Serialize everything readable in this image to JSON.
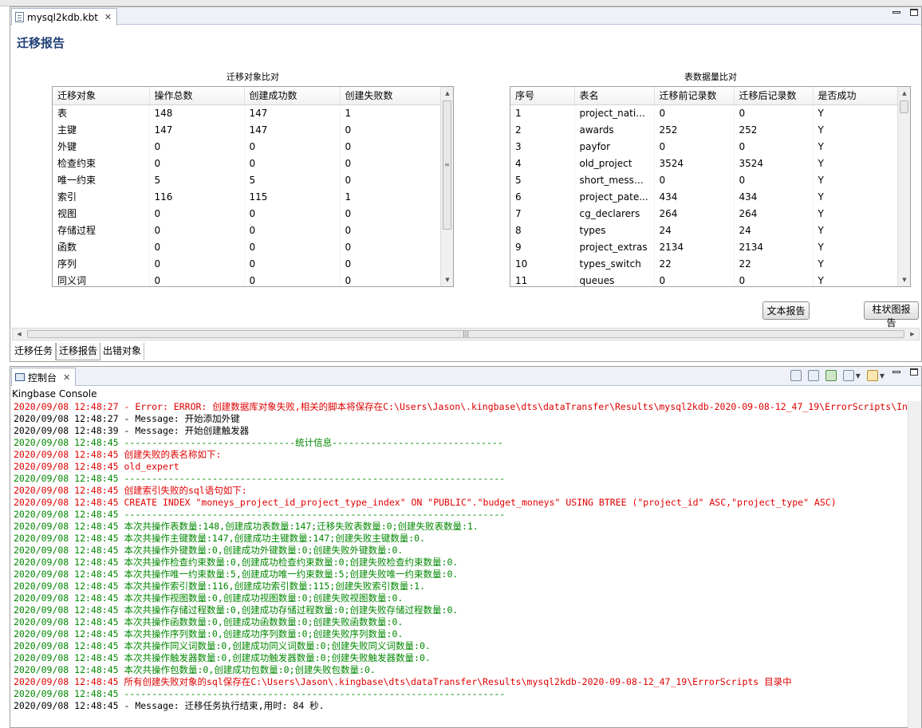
{
  "editor": {
    "tab_label": "mysql2kdb.kbt",
    "report_title": "迁移报告"
  },
  "object_compare": {
    "caption": "迁移对象比对",
    "columns": [
      "迁移对象",
      "操作总数",
      "创建成功数",
      "创建失败数"
    ],
    "rows": [
      [
        "表",
        "148",
        "147",
        "1"
      ],
      [
        "主键",
        "147",
        "147",
        "0"
      ],
      [
        "外键",
        "0",
        "0",
        "0"
      ],
      [
        "检查约束",
        "0",
        "0",
        "0"
      ],
      [
        "唯一约束",
        "5",
        "5",
        "0"
      ],
      [
        "索引",
        "116",
        "115",
        "1"
      ],
      [
        "视图",
        "0",
        "0",
        "0"
      ],
      [
        "存储过程",
        "0",
        "0",
        "0"
      ],
      [
        "函数",
        "0",
        "0",
        "0"
      ],
      [
        "序列",
        "0",
        "0",
        "0"
      ],
      [
        "同义词",
        "0",
        "0",
        "0"
      ]
    ]
  },
  "data_compare": {
    "caption": "表数据量比对",
    "columns": [
      "序号",
      "表名",
      "迁移前记录数",
      "迁移后记录数",
      "是否成功"
    ],
    "rows": [
      [
        "1",
        "project_natio...",
        "0",
        "0",
        "Y"
      ],
      [
        "2",
        "awards",
        "252",
        "252",
        "Y"
      ],
      [
        "3",
        "payfor",
        "0",
        "0",
        "Y"
      ],
      [
        "4",
        "old_project",
        "3524",
        "3524",
        "Y"
      ],
      [
        "5",
        "short_messa...",
        "0",
        "0",
        "Y"
      ],
      [
        "6",
        "project_pate...",
        "434",
        "434",
        "Y"
      ],
      [
        "7",
        "cg_declarers",
        "264",
        "264",
        "Y"
      ],
      [
        "8",
        "types",
        "24",
        "24",
        "Y"
      ],
      [
        "9",
        "project_extras",
        "2134",
        "2134",
        "Y"
      ],
      [
        "10",
        "types_switch",
        "22",
        "22",
        "Y"
      ],
      [
        "11",
        "queues",
        "0",
        "0",
        "Y"
      ]
    ]
  },
  "buttons": {
    "text_report": "文本报告",
    "bar_report": "柱状图报告"
  },
  "bottom_tabs": [
    "迁移任务",
    "迁移报告",
    "出错对象"
  ],
  "console": {
    "tab_label": "控制台",
    "label": "Kingbase Console",
    "colors": {
      "red": "#e00000",
      "green": "#008800",
      "black": "#000000"
    },
    "lines": [
      {
        "color": "red",
        "ts": "2020/09/08 12:48:27",
        "text": " - Error: ERROR: 创建数据库对象失败,相关的脚本将保存在C:\\Users\\Jason\\.kingbase\\dts\\dataTransfer\\Results\\mysql2kdb-2020-09-08-12_47_19\\ErrorScripts\\Indexes"
      },
      {
        "color": "black",
        "ts": "2020/09/08 12:48:27",
        "text": " - Message: 开始添加外键"
      },
      {
        "color": "black",
        "ts": "2020/09/08 12:48:39",
        "text": " - Message: 开始创建触发器"
      },
      {
        "color": "green",
        "ts": "2020/09/08 12:48:45",
        "text": " -------------------------------统计信息-------------------------------"
      },
      {
        "color": "red",
        "ts": "2020/09/08 12:48:45",
        "text": " 创建失败的表名称如下:"
      },
      {
        "color": "red",
        "ts": "2020/09/08 12:48:45",
        "text": " old_expert"
      },
      {
        "color": "green",
        "ts": "2020/09/08 12:48:45",
        "text": " ---------------------------------------------------------------------"
      },
      {
        "color": "red",
        "ts": "2020/09/08 12:48:45",
        "text": " 创建索引失败的sql语句如下:"
      },
      {
        "color": "red",
        "ts": "2020/09/08 12:48:45",
        "text": " CREATE  INDEX \"moneys_project_id_project_type_index\" ON \"PUBLIC\".\"budget_moneys\" USING BTREE (\"project_id\" ASC,\"project_type\" ASC)"
      },
      {
        "color": "green",
        "ts": "2020/09/08 12:48:45",
        "text": " ---------------------------------------------------------------------"
      },
      {
        "color": "green",
        "ts": "2020/09/08 12:48:45",
        "text": " 本次共操作表数量:148,创建成功表数量:147;迁移失败表数量:0;创建失败表数量:1."
      },
      {
        "color": "green",
        "ts": "2020/09/08 12:48:45",
        "text": " 本次共操作主键数量:147,创建成功主键数量:147;创建失败主键数量:0."
      },
      {
        "color": "green",
        "ts": "2020/09/08 12:48:45",
        "text": " 本次共操作外键数量:0,创建成功外键数量:0;创建失败外键数量:0."
      },
      {
        "color": "green",
        "ts": "2020/09/08 12:48:45",
        "text": " 本次共操作检查约束数量:0,创建成功检查约束数量:0;创建失败检查约束数量:0."
      },
      {
        "color": "green",
        "ts": "2020/09/08 12:48:45",
        "text": " 本次共操作唯一约束数量:5,创建成功唯一约束数量:5;创建失败唯一约束数量:0."
      },
      {
        "color": "green",
        "ts": "2020/09/08 12:48:45",
        "text": " 本次共操作索引数量:116,创建成功索引数量:115;创建失败索引数量:1."
      },
      {
        "color": "green",
        "ts": "2020/09/08 12:48:45",
        "text": " 本次共操作视图数量:0,创建成功视图数量:0;创建失败视图数量:0."
      },
      {
        "color": "green",
        "ts": "2020/09/08 12:48:45",
        "text": " 本次共操作存储过程数量:0,创建成功存储过程数量:0;创建失败存储过程数量:0."
      },
      {
        "color": "green",
        "ts": "2020/09/08 12:48:45",
        "text": " 本次共操作函数数量:0,创建成功函数数量:0;创建失败函数数量:0."
      },
      {
        "color": "green",
        "ts": "2020/09/08 12:48:45",
        "text": " 本次共操作序列数量:0,创建成功序列数量:0;创建失败序列数量:0."
      },
      {
        "color": "green",
        "ts": "2020/09/08 12:48:45",
        "text": " 本次共操作同义词数量:0,创建成功同义词数量:0;创建失败同义词数量:0."
      },
      {
        "color": "green",
        "ts": "2020/09/08 12:48:45",
        "text": " 本次共操作触发器数量:0,创建成功触发器数量:0;创建失败触发器数量:0."
      },
      {
        "color": "green",
        "ts": "2020/09/08 12:48:45",
        "text": " 本次共操作包数量:0,创建成功包数量:0;创建失败包数量:0."
      },
      {
        "color": "red",
        "ts": "2020/09/08 12:48:45",
        "text": " 所有创建失败对象的sql保存在C:\\Users\\Jason\\.kingbase\\dts\\dataTransfer\\Results\\mysql2kdb-2020-09-08-12_47_19\\ErrorScripts 目录中"
      },
      {
        "color": "green",
        "ts": "2020/09/08 12:48:45",
        "text": " ---------------------------------------------------------------------"
      },
      {
        "color": "black",
        "ts": "2020/09/08 12:48:45",
        "text": " - Message: 迁移任务执行结束,用时: 84 秒."
      }
    ]
  }
}
